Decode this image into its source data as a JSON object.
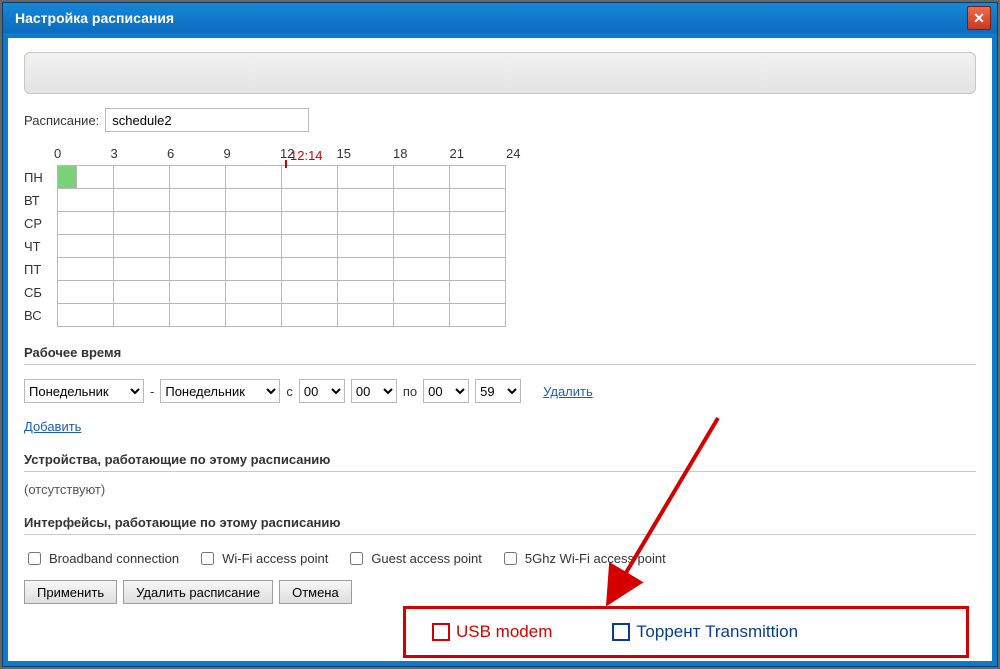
{
  "window": {
    "title": "Настройка расписания"
  },
  "schedule": {
    "label": "Расписание:",
    "value": "schedule2"
  },
  "grid": {
    "hours": [
      "0",
      "3",
      "6",
      "9",
      "12",
      "15",
      "18",
      "21",
      "24"
    ],
    "days": [
      "ПН",
      "ВТ",
      "СР",
      "ЧТ",
      "ПТ",
      "СБ",
      "ВС"
    ],
    "current_time": "12:14"
  },
  "work_time": {
    "title": "Рабочее время",
    "dash": "-",
    "from_c": "с",
    "to_po": "по",
    "day_from": "Понедельник",
    "day_to": "Понедельник",
    "h_from": "00",
    "m_from": "00",
    "h_to": "00",
    "m_to": "59",
    "delete": "Удалить",
    "add": "Добавить"
  },
  "devices": {
    "title": "Устройства, работающие по этому расписанию",
    "none": "(отсутствуют)"
  },
  "interfaces": {
    "title": "Интерфейсы, работающие по этому расписанию",
    "items": [
      "Broadband connection",
      "Wi-Fi access point",
      "Guest access point",
      "5Ghz Wi-Fi access point"
    ]
  },
  "buttons": {
    "apply": "Применить",
    "delete_schedule": "Удалить расписание",
    "cancel": "Отмена"
  },
  "annotations": {
    "usb_modem": "USB modem",
    "torrent": "Торрент Transmittion"
  }
}
